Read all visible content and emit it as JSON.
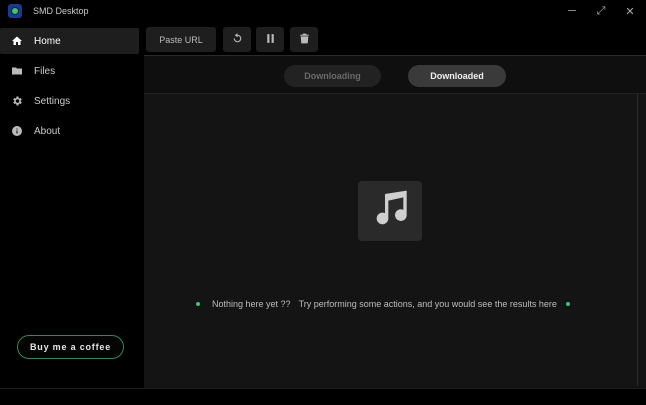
{
  "window": {
    "title": "SMD Desktop",
    "controls": {
      "minimize": "─",
      "maximize": "⤢",
      "close": "✕"
    }
  },
  "sidebar": {
    "items": [
      {
        "label": "Home",
        "icon": "home-icon",
        "active": true
      },
      {
        "label": "Files",
        "icon": "folder-icon",
        "active": false
      },
      {
        "label": "Settings",
        "icon": "gear-icon",
        "active": false
      },
      {
        "label": "About",
        "icon": "info-icon",
        "active": false
      }
    ],
    "coffee_label": "Buy me a coffee"
  },
  "toolbar": {
    "paste_label": "Paste URL",
    "icons": [
      "refresh-icon",
      "pause-icon",
      "trash-icon"
    ]
  },
  "tabs": [
    {
      "label": "Downloading",
      "active": false
    },
    {
      "label": "Downloaded",
      "active": true
    }
  ],
  "empty_state": {
    "icon": "music-note-icon",
    "title": "Nothing here yet ??",
    "message": "Try performing some actions, and you would see the results here"
  },
  "colors": {
    "accent": "#3ec46d",
    "background": "#000000",
    "panel": "#141414"
  }
}
